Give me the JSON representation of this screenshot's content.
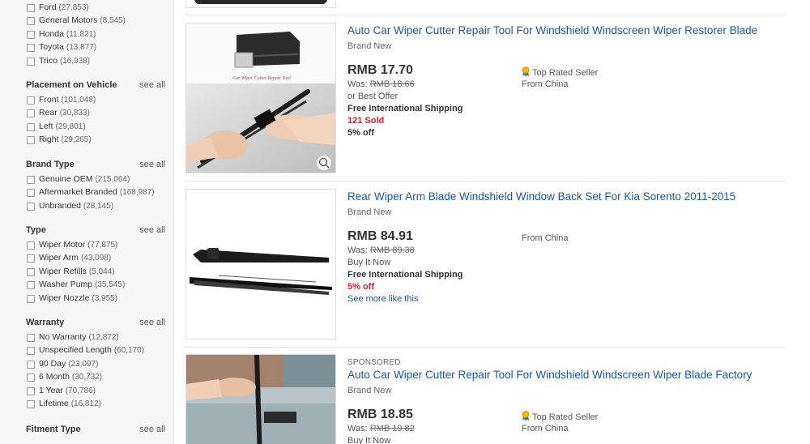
{
  "sidebar": {
    "make_options": [
      {
        "label": "Ford",
        "count": "(27,853)"
      },
      {
        "label": "General Motors",
        "count": "(8,545)"
      },
      {
        "label": "Honda",
        "count": "(11,821)"
      },
      {
        "label": "Toyota",
        "count": "(13,877)"
      },
      {
        "label": "Trico",
        "count": "(16,938)"
      }
    ],
    "placement": {
      "title": "Placement on Vehicle",
      "see_all": "see all",
      "options": [
        {
          "label": "Front",
          "count": "(101,048)"
        },
        {
          "label": "Rear",
          "count": "(30,833)"
        },
        {
          "label": "Left",
          "count": "(29,801)"
        },
        {
          "label": "Right",
          "count": "(29,265)"
        }
      ]
    },
    "brand_type": {
      "title": "Brand Type",
      "see_all": "see all",
      "options": [
        {
          "label": "Genuine OEM",
          "count": "(215,064)"
        },
        {
          "label": "Aftermarket Branded",
          "count": "(168,987)"
        },
        {
          "label": "Unbranded",
          "count": "(28,145)"
        }
      ]
    },
    "type": {
      "title": "Type",
      "see_all": "see all",
      "options": [
        {
          "label": "Wiper Motor",
          "count": "(77,875)"
        },
        {
          "label": "Wiper Arm",
          "count": "(43,098)"
        },
        {
          "label": "Wiper Refills",
          "count": "(5,044)"
        },
        {
          "label": "Washer Pump",
          "count": "(35,545)"
        },
        {
          "label": "Wiper Nozzle",
          "count": "(3,955)"
        }
      ]
    },
    "warranty": {
      "title": "Warranty",
      "see_all": "see all",
      "options": [
        {
          "label": "No Warranty",
          "count": "(12,872)"
        },
        {
          "label": "Unspecified Length",
          "count": "(60,170)"
        },
        {
          "label": "90 Day",
          "count": "(23,097)"
        },
        {
          "label": "6 Month",
          "count": "(30,732)"
        },
        {
          "label": "1 Year",
          "count": "(70,786)"
        },
        {
          "label": "Lifetime",
          "count": "(16,812)"
        }
      ]
    },
    "fitment": {
      "title": "Fitment Type",
      "see_all": "see all"
    }
  },
  "listings": [
    {
      "title": "Auto Car Wiper Cutter Repair Tool For Windshield Windscreen Wiper Restorer Blade",
      "condition": "Brand New",
      "price": "RMB 17.70",
      "was_label": "Was:",
      "was_value": "RMB 18.66",
      "buy_format": "or Best Offer",
      "shipping": "Free International Shipping",
      "sold": "121 Sold",
      "discount": "5% off",
      "seller_badge": "Top Rated Seller",
      "location": "From China",
      "image_caption": "Car Wiper Cutter Repair Tool"
    },
    {
      "title": "Rear Wiper Arm Blade Windshield Window Back Set For Kia Sorento 2011-2015",
      "condition": "Brand New",
      "price": "RMB 84.91",
      "was_label": "Was:",
      "was_value": "RMB 89.38",
      "buy_format": "Buy It Now",
      "shipping": "Free International Shipping",
      "discount": "5% off",
      "see_more": "See more like this",
      "location": "From China"
    },
    {
      "sponsored": "SPONSORED",
      "title": "Auto Car Wiper Cutter Repair Tool For Windshield Windscreen Wiper Blade Factory",
      "condition": "Brand New",
      "price": "RMB 18.85",
      "was_label": "Was:",
      "was_value": "RMB 19.82",
      "buy_format": "Buy It Now",
      "seller_badge": "Top Rated Seller",
      "location": "From China"
    }
  ],
  "colors": {
    "link": "#1a57a8",
    "sold_red": "#dd1e31",
    "sidebar_bg": "#f7f7f7"
  }
}
